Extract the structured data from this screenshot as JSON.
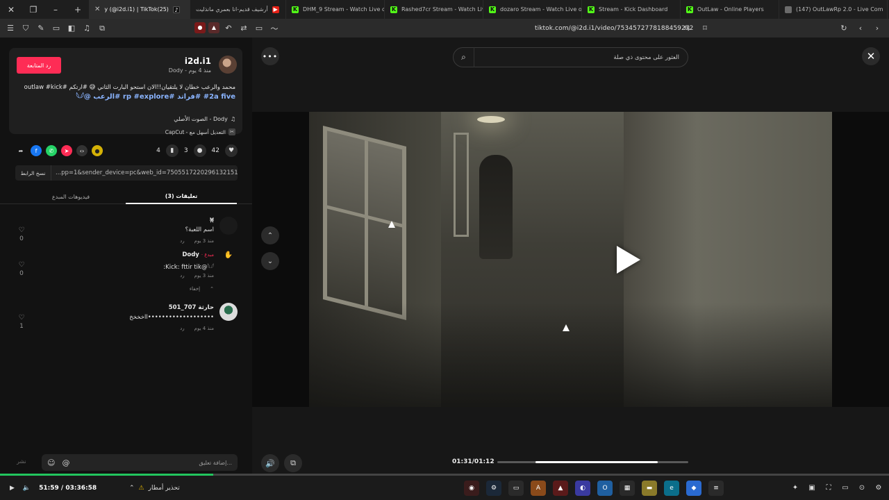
{
  "browser": {
    "tabs": [
      {
        "label": "y (@i2d.i1) | TikTok(25)",
        "icon": "tiktok-icon",
        "active": true
      },
      {
        "label": "أرشيف قديم-انا بعمري مانذليت",
        "icon": "youtube-icon"
      },
      {
        "label": "DHM_9 Stream - Watch Live o",
        "icon": "kick-icon"
      },
      {
        "label": "Rashed7cr Stream - Watch Live",
        "icon": "kick-icon"
      },
      {
        "label": "dozaro Stream - Watch Live o",
        "icon": "kick-icon"
      },
      {
        "label": "Stream - Kick Dashboard",
        "icon": "kick-icon"
      },
      {
        "label": "OutLaw - Online Players",
        "icon": "kick-icon"
      },
      {
        "label": "(147) OutLawRp 2.0 - Live Com",
        "icon": "generic-icon"
      }
    ],
    "url": "tiktok.com/@i2d.i1/video/7534572778188459272"
  },
  "post": {
    "follow_label": "رد المتابعة",
    "username": "i2d.i1",
    "author_meta": "Dody - منذ 4 يوم",
    "caption": "محمد والرعب خطان لا يلتقيان!!الان استحو البارت الثاني 😅 #ارتكم #outlaw #kick",
    "hashtags": "#2a five #فراتد #rp #explore #الرعب @𓆩𓆪",
    "sound": "الصوت الأصلي - Dody",
    "capcut": "CapCut - التعديل أسهل مع",
    "likes": "42",
    "comments": "3",
    "saves": "4",
    "copy_link_label": "نسخ الرابط",
    "link_text": "...pp=1&sender_device=pc&web_id=7505517220296132151"
  },
  "panel_tabs": {
    "creator_videos": "فيديوهات المبدع",
    "comments": "تعليقات (3)"
  },
  "comments": [
    {
      "name": "𐦍",
      "text": "اسم اللعبة؟",
      "time": "منذ 3 يوم",
      "reply": "رد",
      "likes": "0"
    },
    {
      "name": "Dody",
      "badge": "· مبدع",
      "text": ":Kick: fttir tik@𓆩𓆪",
      "time": "منذ 3 يوم",
      "reply": "رد",
      "likes": "0",
      "hide": "إخفاء"
    },
    {
      "name": "حارثة 707_501",
      "text": "ااخخخخ•••••••••••••••••••",
      "time": "منذ 4 يوم",
      "reply": "رد",
      "likes": "1"
    }
  ],
  "comment_box": {
    "placeholder": "إضافة تعليق...",
    "post_label": "نشر"
  },
  "video": {
    "search_placeholder": "العثور على محتوى ذي صلة",
    "time": "01:31/01:12",
    "progress": 0.8
  },
  "player": {
    "time": "51:59 / 03:36:58",
    "progress": 0.24,
    "warning": "تحذير أمطار"
  }
}
